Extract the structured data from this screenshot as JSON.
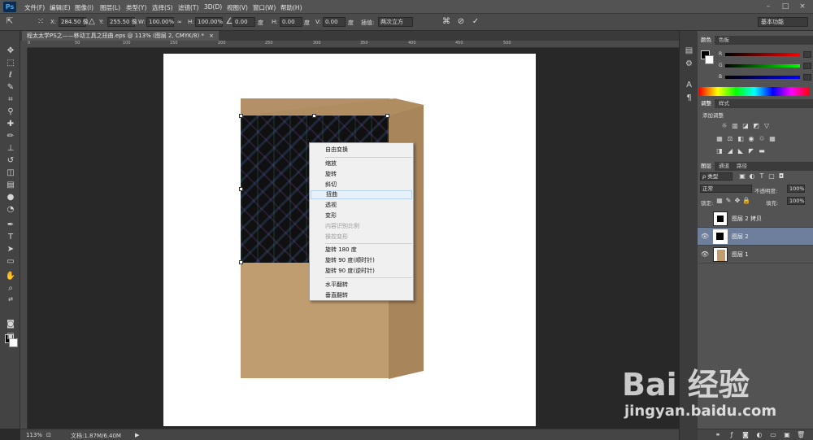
{
  "app": {
    "logo": "Ps"
  },
  "menubar": {
    "items": [
      "文件(F)",
      "编辑(E)",
      "图像(I)",
      "图层(L)",
      "类型(Y)",
      "选择(S)",
      "滤镜(T)",
      "3D(D)",
      "视图(V)",
      "窗口(W)",
      "帮助(H)"
    ],
    "window_controls": [
      "–",
      "□",
      "×"
    ]
  },
  "options_bar": {
    "x_label": "X:",
    "x_value": "284.50 像",
    "y_label": "Y:",
    "y_value": "255.50 像",
    "w_label": "W:",
    "w_value": "100.00%",
    "link_label": "∞",
    "h_label": "H:",
    "h_value": "100.00%",
    "angle_value": "0.00",
    "angle_unit": "度",
    "hskew_label": "H:",
    "hskew_value": "0.00",
    "hskew_unit": "度",
    "vskew_label": "V:",
    "vskew_value": "0.00",
    "vskew_unit": "度",
    "interp_label": "插值:",
    "interp_value": "两次立方",
    "workspace": "基本功能"
  },
  "document": {
    "tab_title": "程太太学PS之——移动工具之扭曲.eps @ 113% (图层 2, CMYK/8) *",
    "tab_close": "×"
  },
  "context_menu": {
    "items": [
      {
        "label": "自由变换",
        "disabled": false
      },
      {
        "label": "缩放",
        "disabled": false
      },
      {
        "label": "旋转",
        "disabled": false
      },
      {
        "label": "斜切",
        "disabled": false
      },
      {
        "label": "扭曲",
        "disabled": false,
        "highlighted": true
      },
      {
        "label": "透视",
        "disabled": false
      },
      {
        "label": "变形",
        "disabled": false
      },
      {
        "label": "内容识别比例",
        "disabled": true
      },
      {
        "label": "操控变形",
        "disabled": true
      },
      {
        "label": "旋转 180 度",
        "disabled": false
      },
      {
        "label": "旋转 90 度(顺时针)",
        "disabled": false
      },
      {
        "label": "旋转 90 度(逆时针)",
        "disabled": false
      },
      {
        "label": "水平翻转",
        "disabled": false
      },
      {
        "label": "垂直翻转",
        "disabled": false
      }
    ]
  },
  "status_bar": {
    "zoom": "113%",
    "doc_info": "文档:1.87M/6.40M",
    "arrow": "▶"
  },
  "panels": {
    "color_tabs": [
      "颜色",
      "色板"
    ],
    "color_labels": [
      "R",
      "G",
      "B"
    ],
    "adjust_tabs": [
      "调整",
      "样式"
    ],
    "adjust_title": "添加调整",
    "layers_tabs": [
      "图层",
      "通道",
      "路径"
    ],
    "filter_kind": "ρ 类型",
    "blend_mode": "正常",
    "opacity_label": "不透明度:",
    "opacity_value": "100%",
    "lock_label": "锁定:",
    "fill_label": "填充:",
    "fill_value": "100%",
    "layers": [
      {
        "name": "图层 2 拷贝",
        "visible": false,
        "selected": false
      },
      {
        "name": "图层 2",
        "visible": true,
        "selected": true
      },
      {
        "name": "图层 1",
        "visible": true,
        "selected": false
      }
    ]
  },
  "watermark": {
    "logo": "Bai 经验",
    "url": "jingyan.baidu.com"
  },
  "colors": {
    "box_front": "#c09d70",
    "box_side": "#a8855a",
    "box_top": "#b08d60",
    "selected_layer": "#6d7f9a"
  }
}
